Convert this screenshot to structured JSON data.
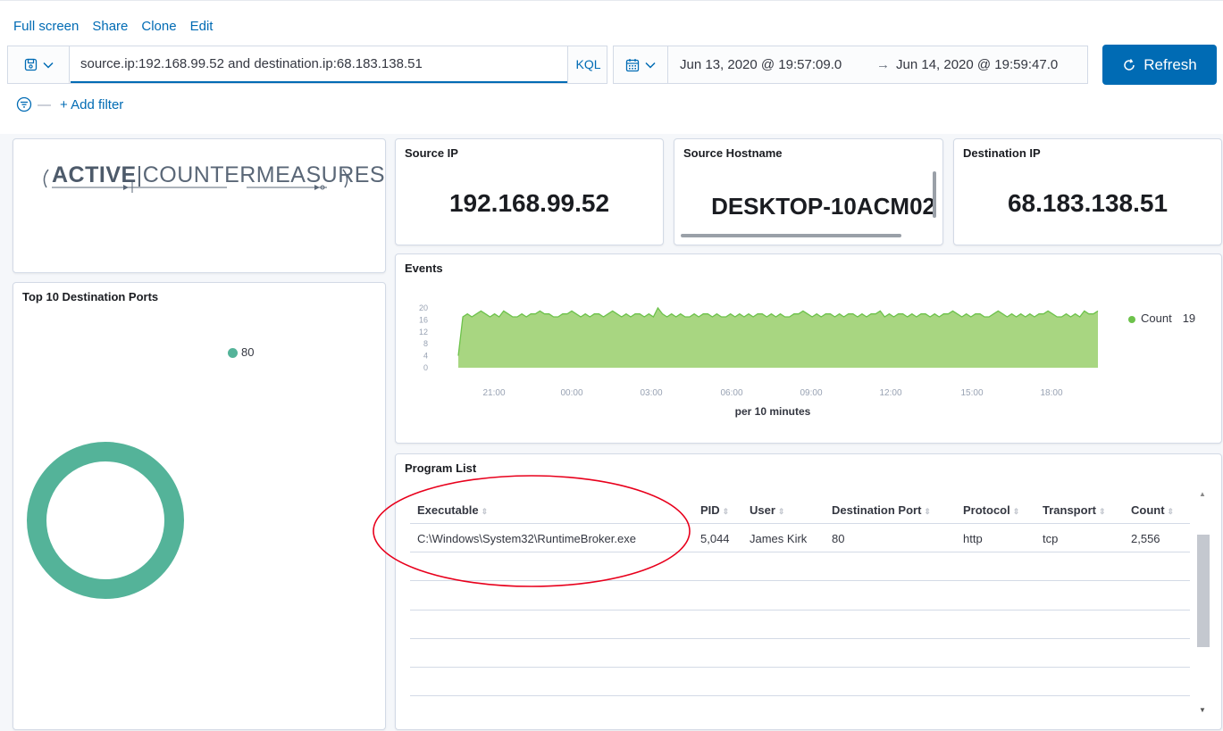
{
  "topmenu": {
    "full_screen": "Full screen",
    "share": "Share",
    "clone": "Clone",
    "edit": "Edit"
  },
  "query": {
    "value": "source.ip:192.168.99.52 and destination.ip:68.183.138.51",
    "language": "KQL"
  },
  "time": {
    "start": "Jun 13, 2020 @ 19:57:09.0",
    "arrow": "→",
    "end": "Jun 14, 2020 @ 19:59:47.0"
  },
  "refresh_label": "Refresh",
  "filter": {
    "dash": "—",
    "add_label": "+ Add filter"
  },
  "logo": {
    "bold": "ACTIVE",
    "rest": "COUNTERMEASURES"
  },
  "metrics": {
    "source_ip": {
      "title": "Source IP",
      "value": "192.168.99.52"
    },
    "source_hostname": {
      "title": "Source Hostname",
      "value": "DESKTOP-10ACM02"
    },
    "destination_ip": {
      "title": "Destination IP",
      "value": "68.183.138.51"
    }
  },
  "ports_panel": {
    "title": "Top 10 Destination Ports",
    "legend": "80"
  },
  "events_panel": {
    "title": "Events",
    "legend_label": "Count",
    "legend_value": "19"
  },
  "program_list": {
    "title": "Program List",
    "columns": [
      "Executable",
      "PID",
      "User",
      "Destination Port",
      "Protocol",
      "Transport",
      "Count"
    ],
    "rows": [
      [
        "C:\\Windows\\System32\\RuntimeBroker.exe",
        "5,044",
        "James Kirk",
        "80",
        "http",
        "tcp",
        "2,556"
      ]
    ]
  },
  "colors": {
    "accent": "#006bb4",
    "series": "#54b399",
    "area": "#a8d681",
    "annotation": "#e8001c"
  },
  "chart_data": [
    {
      "type": "pie",
      "title": "Top 10 Destination Ports",
      "categories": [
        "80"
      ],
      "values": [
        100
      ],
      "donut": true,
      "legend": "top-right"
    },
    {
      "type": "area",
      "title": "Events",
      "xlabel": "per 10 minutes",
      "ylabel": "",
      "ylim": [
        0,
        20
      ],
      "yticks": [
        "0",
        "4",
        "8",
        "12",
        "16",
        "20"
      ],
      "xticks": [
        "21:00",
        "00:00",
        "03:00",
        "06:00",
        "09:00",
        "12:00",
        "15:00",
        "18:00"
      ],
      "series": [
        {
          "name": "Count",
          "values": [
            4,
            17,
            18,
            17,
            18,
            19,
            18,
            17,
            18,
            17,
            19,
            18,
            17,
            17,
            18,
            17,
            18,
            18,
            19,
            18,
            18,
            17,
            17,
            18,
            18,
            19,
            18,
            17,
            18,
            17,
            18,
            18,
            17,
            18,
            19,
            18,
            17,
            18,
            17,
            18,
            18,
            17,
            18,
            17,
            20,
            18,
            17,
            18,
            17,
            18,
            17,
            17,
            18,
            17,
            18,
            18,
            17,
            18,
            17,
            17,
            18,
            17,
            18,
            17,
            18,
            17,
            18,
            18,
            17,
            18,
            17,
            18,
            17,
            17,
            18,
            18,
            19,
            18,
            17,
            18,
            17,
            18,
            18,
            17,
            18,
            17,
            18,
            18,
            17,
            18,
            17,
            18,
            18,
            19,
            17,
            18,
            17,
            18,
            18,
            17,
            18,
            17,
            18,
            18,
            17,
            18,
            17,
            18,
            18,
            19,
            18,
            17,
            18,
            17,
            18,
            18,
            17,
            17,
            18,
            19,
            18,
            17,
            18,
            17,
            18,
            17,
            18,
            17,
            18,
            18,
            19,
            18,
            17,
            17,
            18,
            17,
            18,
            17,
            19,
            18,
            18,
            19
          ]
        }
      ],
      "legend": "right"
    }
  ]
}
